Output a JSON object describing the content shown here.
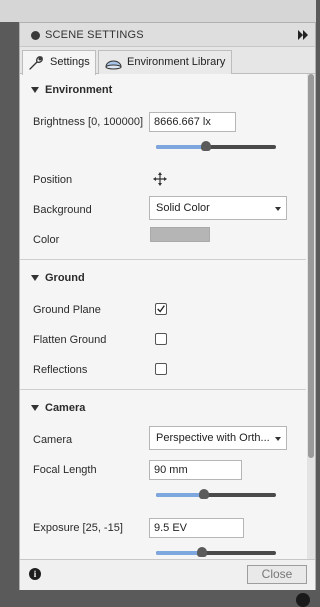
{
  "panel": {
    "title": "SCENE SETTINGS"
  },
  "tabs": [
    {
      "label": "Settings",
      "icon": "wrench-icon",
      "active": true
    },
    {
      "label": "Environment Library",
      "icon": "dome-icon",
      "active": false
    }
  ],
  "environment": {
    "heading": "Environment",
    "brightness_label": "Brightness [0, 100000]",
    "brightness_value": "8666.667 lx",
    "brightness_slider_fraction": 0.42,
    "position_label": "Position",
    "background_label": "Background",
    "background_value": "Solid Color",
    "color_label": "Color",
    "color_value": "#b5b5b5"
  },
  "ground": {
    "heading": "Ground",
    "ground_plane_label": "Ground Plane",
    "ground_plane_checked": true,
    "flatten_label": "Flatten Ground",
    "flatten_checked": false,
    "reflections_label": "Reflections",
    "reflections_checked": false
  },
  "camera": {
    "heading": "Camera",
    "camera_label": "Camera",
    "camera_value": "Perspective with Orth...",
    "focal_label": "Focal Length",
    "focal_value": "90 mm",
    "focal_slider_fraction": 0.4,
    "exposure_label": "Exposure [25, -15]",
    "exposure_value": "9.5 EV",
    "exposure_slider_fraction": 0.38
  },
  "footer": {
    "close_label": "Close"
  },
  "colors": {
    "accent": "#7fa7df",
    "track": "#4a4a4a"
  }
}
